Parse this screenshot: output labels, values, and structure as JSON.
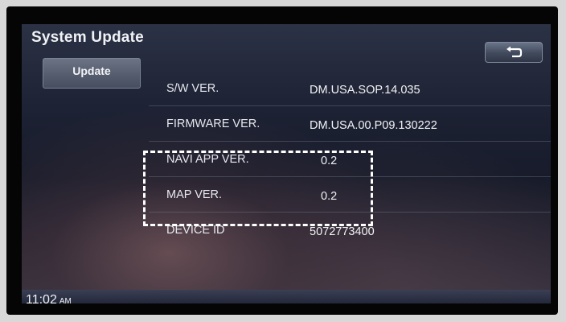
{
  "title": "System Update",
  "side_tab": {
    "label": "Update"
  },
  "back_button": {
    "icon": "back-arrow-icon"
  },
  "rows": [
    {
      "label": "S/W VER.",
      "value": "DM.USA.SOP.14.035"
    },
    {
      "label": "FIRMWARE VER.",
      "value": "DM.USA.00.P09.130222"
    },
    {
      "label": "NAVI APP VER.",
      "value": "0.2"
    },
    {
      "label": "MAP VER.",
      "value": "0.2"
    },
    {
      "label": "DEVICE ID",
      "value": "5072773400"
    }
  ],
  "status": {
    "time": "11:02",
    "ampm": "AM"
  },
  "colors": {
    "text": "#f0f2f5",
    "highlight_border": "#ffffff"
  }
}
